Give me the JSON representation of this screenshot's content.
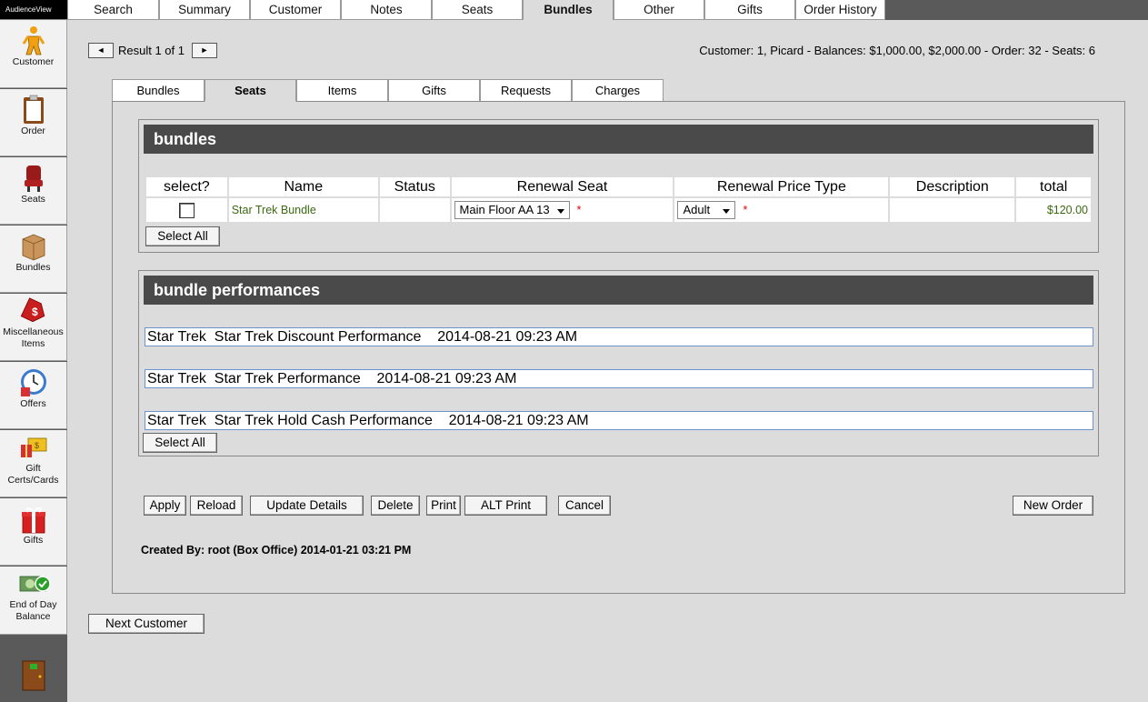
{
  "sidebar": {
    "brand": "AudienceView",
    "items": [
      {
        "label": "Customer",
        "icon": "person-icon"
      },
      {
        "label": "Order",
        "icon": "clipboard-icon"
      },
      {
        "label": "Seats",
        "icon": "seat-icon"
      },
      {
        "label": "Bundles",
        "icon": "box-icon"
      },
      {
        "label": "Miscellaneous Items",
        "icon": "price-tag-icon"
      },
      {
        "label": "Offers",
        "icon": "clock-icon"
      },
      {
        "label": "Gift Certs/Cards",
        "icon": "gift-card-icon"
      },
      {
        "label": "Gifts",
        "icon": "gift-box-icon"
      },
      {
        "label": "End of Day Balance",
        "icon": "cash-check-icon"
      }
    ],
    "exit_icon": "exit-door-icon"
  },
  "top_tabs": [
    "Search",
    "Summary",
    "Customer",
    "Notes",
    "Seats",
    "Bundles",
    "Other",
    "Gifts",
    "Order History"
  ],
  "top_active": "Bundles",
  "nav": {
    "prev": "◄",
    "next": "►",
    "result": "Result 1 of 1",
    "customer_info": "Customer: 1, Picard - Balances: $1,000.00, $2,000.00 - Order: 32 - Seats: 6"
  },
  "sub_tabs": [
    "Bundles",
    "Seats",
    "Items",
    "Gifts",
    "Requests",
    "Charges"
  ],
  "sub_active": "Seats",
  "bundles": {
    "title": "bundles",
    "headers": [
      "select?",
      "Name",
      "Status",
      "Renewal Seat",
      "Renewal Price Type",
      "Description",
      "total"
    ],
    "row": {
      "name": "Star Trek Bundle",
      "status": "",
      "renewal_seat": "Main Floor AA 13",
      "renewal_price_type": "Adult",
      "description": "",
      "total": "$120.00",
      "required_mark": "*"
    },
    "select_all": "Select All"
  },
  "performances": {
    "title": "bundle performances",
    "items": [
      "Star Trek  Star Trek Discount Performance    2014-08-21 09:23 AM",
      "Star Trek  Star Trek Performance    2014-08-21 09:23 AM",
      "Star Trek  Star Trek Hold Cash Performance    2014-08-21 09:23 AM"
    ],
    "select_all": "Select All"
  },
  "actions": {
    "apply": "Apply",
    "reload": "Reload",
    "update_details": "Update Details",
    "delete": "Delete",
    "print": "Print",
    "alt_print": "ALT Print",
    "cancel": "Cancel",
    "new_order": "New Order"
  },
  "created_by": "Created By: root (Box Office) 2014-01-21 03:21 PM",
  "next_customer": "Next Customer"
}
